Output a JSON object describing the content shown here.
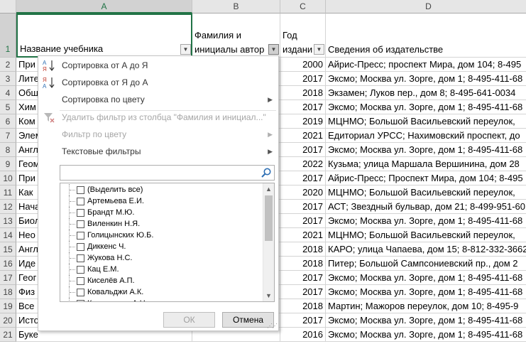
{
  "columns": [
    "A",
    "B",
    "C",
    "D"
  ],
  "row_numbers": [
    "1",
    "2",
    "3",
    "4",
    "5",
    "6",
    "7",
    "8",
    "9",
    "10",
    "11",
    "12",
    "13",
    "14",
    "15",
    "16",
    "17",
    "18",
    "19",
    "20",
    "21"
  ],
  "headers": {
    "a": "Название учебника",
    "b1": "Фамилия и",
    "b2": "инициалы автор",
    "c1": "Год",
    "c2": "издани",
    "d": "Сведения об издательстве"
  },
  "rows": [
    {
      "a": "При",
      "c": "2000",
      "d": "Айрис-Пресс; проспект Мира, дом 104; 8-495"
    },
    {
      "a": "Лите",
      "c": "2017",
      "d": "Эксмо; Москва ул. Зорге, дом 1; 8-495-411-68"
    },
    {
      "a": "Общ",
      "c": "2018",
      "d": "Экзамен; Луков пер., дом 8; 8-495-641-0034"
    },
    {
      "a": "Хим",
      "c": "2017",
      "d": "Эксмо; Москва ул. Зорге, дом 1; 8-495-411-68"
    },
    {
      "a": "Ком",
      "c": "2019",
      "d": "МЦНМО; Большой Васильевский переулок,"
    },
    {
      "a": "Элем",
      "c": "2021",
      "d": "Едиториал УРСС; Нахимовский проспект, до"
    },
    {
      "a": "Англ",
      "c": "2017",
      "d": "Эксмо; Москва ул. Зорге, дом 1; 8-495-411-68"
    },
    {
      "a": "Геом",
      "c": "2022",
      "d": "Кузьма; улица Маршала Вершинина, дом 28"
    },
    {
      "a": "При",
      "c": "2017",
      "d": "Айрис-Пресс; Проспект Мира, дом 104; 8-495"
    },
    {
      "a": "Как",
      "c": "2020",
      "d": "МЦНМО; Большой Васильевский переулок,"
    },
    {
      "a": "Нача",
      "c": "2017",
      "d": "АСТ; Звездный бульвар, дом 21; 8-499-951-60"
    },
    {
      "a": "Биол",
      "c": "2017",
      "d": "Эксмо; Москва ул. Зорге, дом 1; 8-495-411-68"
    },
    {
      "a": "Нео",
      "c": "2021",
      "d": "МЦНМО; Большой Васильевский переулок,"
    },
    {
      "a": "Англ",
      "c": "2018",
      "d": "КАРО; улица Чапаева, дом 15; 8-812-332-3662"
    },
    {
      "a": "Иде",
      "c": "2018",
      "d": "Питер; Большой Сампсониевский пр., дом 2"
    },
    {
      "a": "Геог",
      "c": "2017",
      "d": "Эксмо; Москва ул. Зорге, дом 1; 8-495-411-68"
    },
    {
      "a": "Физ",
      "c": "2017",
      "d": "Эксмо; Москва ул. Зорге, дом 1; 8-495-411-68"
    },
    {
      "a": "Все",
      "c": "2018",
      "d": "Мартин; Мажоров переулок, дом 10; 8-495-9"
    },
    {
      "a": "Исто",
      "c": "2017",
      "d": "Эксмо; Москва ул. Зорге, дом 1; 8-495-411-68"
    },
    {
      "a": "Буке",
      "c": "2016",
      "d": "Эксмо; Москва ул. Зорге, дом 1; 8-495-411-68"
    }
  ],
  "menu": {
    "sort_asc": "Сортировка от А до Я",
    "sort_desc": "Сортировка от Я до А",
    "sort_color": "Сортировка по цвету",
    "clear_filter": "Удалить фильтр из столбца \"Фамилия и инициал...\"",
    "filter_color": "Фильтр по цвету",
    "text_filters": "Текстовые фильтры",
    "search_value": "",
    "list_items": [
      "(Выделить все)",
      "Артемьева Е.И.",
      "Брандт М.Ю.",
      "Виленкин Н.Я.",
      "Голицынских Ю.Б.",
      "Диккенс Ч.",
      "Жукова Н.С.",
      "Кац Е.М.",
      "Киселёв А.П.",
      "Ковальджи А.К.",
      "Колмогоров А.Н."
    ],
    "ok": "ОК",
    "cancel": "Отмена"
  },
  "colors": {
    "accent_green": "#217346",
    "menu_icon_blue": "#2e6fb4",
    "menu_icon_red": "#c0392b"
  },
  "icons": [
    "sort-asc-icon",
    "sort-desc-icon",
    "clear-filter-icon",
    "search-icon",
    "submenu-arrow-icon",
    "filter-dropdown-icon"
  ]
}
